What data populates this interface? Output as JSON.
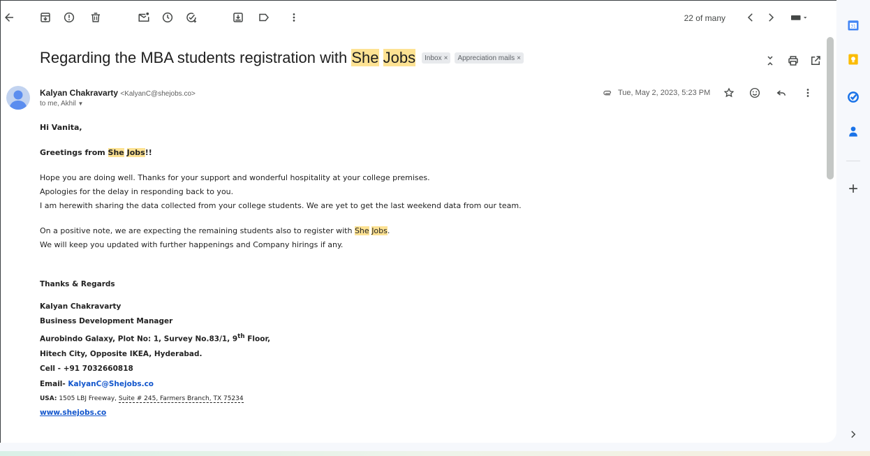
{
  "toolbar": {
    "counter": "22 of many"
  },
  "email": {
    "subject_pre": "Regarding the MBA students registration with ",
    "subject_hl1": "She",
    "subject_hl2": "Jobs",
    "labels": [
      {
        "text": "Inbox",
        "close": "×"
      },
      {
        "text": "Appreciation mails",
        "close": "×"
      }
    ],
    "sender_name": "Kalyan Chakravarty",
    "sender_email": "<KalyanC@shejobs.co>",
    "to_line": "to me, Akhil",
    "date": "Tue, May 2, 2023, 5:23 PM"
  },
  "body": {
    "greeting": "Hi Vanita,",
    "greetings_pre": "Greetings from ",
    "she": "She",
    "jobs": "Jobs",
    "greetings_post": "!!",
    "line1": "Hope you are doing well. Thanks for your support and wonderful hospitality at your college premises.",
    "line2": "Apologies for the delay in responding back to you.",
    "line3": "I am herewith sharing the data collected from your college students. We are yet to get the last weekend data from our team.",
    "line4_pre": "On a positive note, we are expecting the remaining students also to register with ",
    "line4_post": ".",
    "line5": "We will keep you updated with further happenings and Company hirings if any."
  },
  "signature": {
    "regards": "Thanks & Regards",
    "name": "Kalyan Chakravarty",
    "title": "Business Development Manager",
    "address1_pre": "Aurobindo Galaxy, Plot No: 1, Survey No.83/1, 9",
    "address1_sup": "th",
    "address1_post": " Floor,",
    "address2": "Hitech City, Opposite IKEA, Hyderabad.",
    "cell": "Cell - +91 7032660818",
    "email_label": "Email- ",
    "email_value": "KalyanC@Shejobs.co",
    "usa_label": "USA:",
    "usa_pre": " 1505 LBJ Freeway, ",
    "usa_dashed": "Suite # 245, Farmers Branch, TX 75234",
    "website": "www.shejobs.co"
  },
  "colors": {
    "highlight": "#fde293",
    "link": "#1155cc",
    "calendar": "#4285f4",
    "keep": "#fbbc04",
    "tasks": "#1a73e8",
    "contacts": "#1a73e8"
  }
}
